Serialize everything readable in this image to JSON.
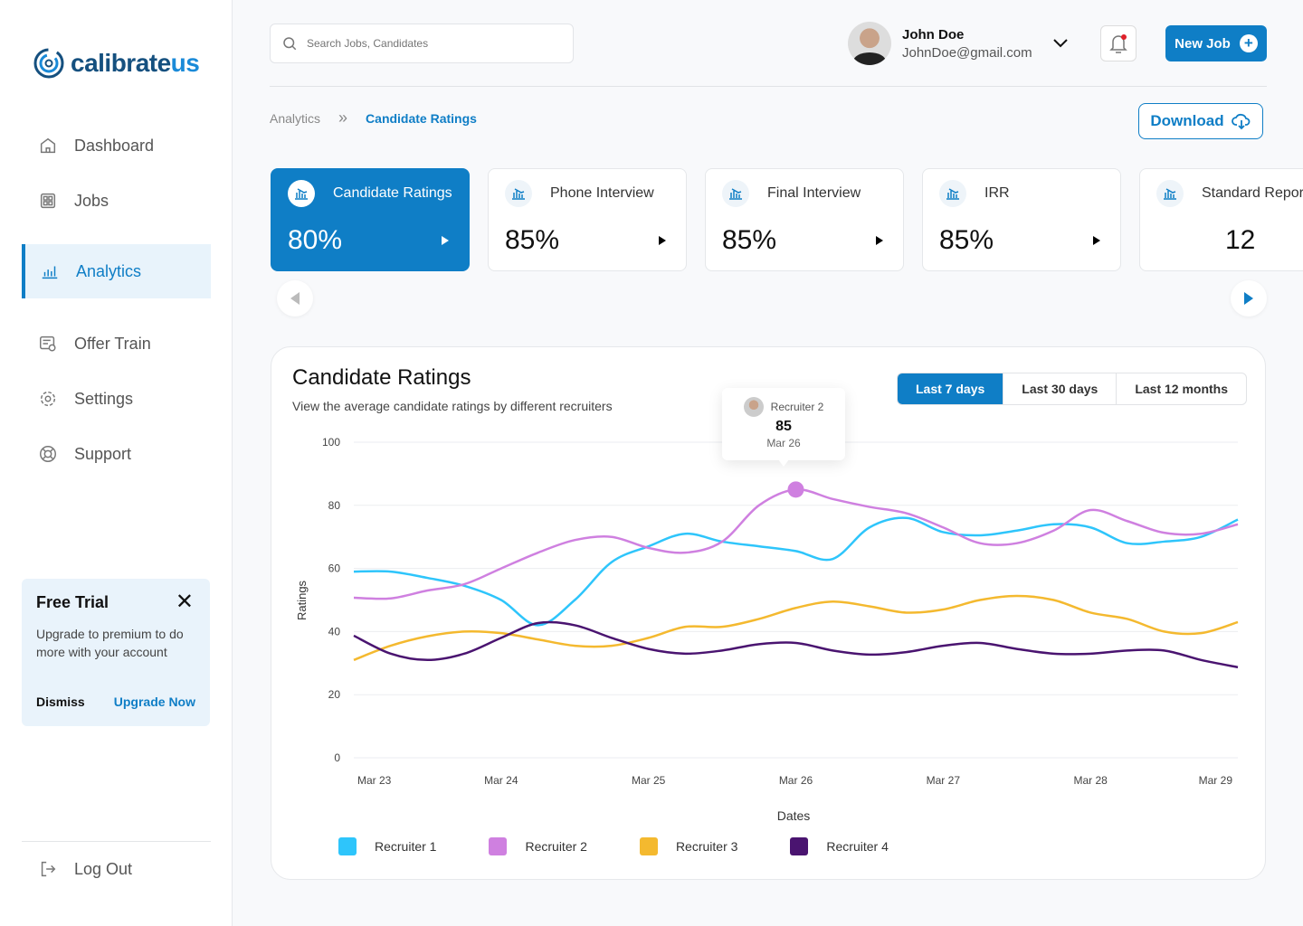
{
  "brand": {
    "name_a": "calibrate",
    "name_b": "us"
  },
  "sidebar": {
    "items": [
      {
        "label": "Dashboard",
        "icon": "home-icon"
      },
      {
        "label": "Jobs",
        "icon": "grid-icon"
      },
      {
        "label": "Analytics",
        "icon": "bar-chart-icon",
        "active": true
      },
      {
        "label": "Offer Train",
        "icon": "document-settings-icon"
      },
      {
        "label": "Settings",
        "icon": "gear-icon"
      },
      {
        "label": "Support",
        "icon": "lifebuoy-icon"
      }
    ],
    "logout": "Log Out"
  },
  "trial": {
    "title": "Free Trial",
    "text": "Upgrade to premium to do more with your account",
    "dismiss": "Dismiss",
    "upgrade": "Upgrade Now"
  },
  "header": {
    "search_placeholder": "Search Jobs, Candidates",
    "user_name": "John Doe",
    "user_email": "JohnDoe@gmail.com",
    "new_job": "New Job"
  },
  "breadcrumb": {
    "parent": "Analytics",
    "current": "Candidate Ratings"
  },
  "download": "Download",
  "cards": [
    {
      "label": "Candidate Ratings",
      "value": "80%",
      "active": true
    },
    {
      "label": "Phone Interview",
      "value": "85%"
    },
    {
      "label": "Final Interview",
      "value": "85%"
    },
    {
      "label": "IRR",
      "value": "85%"
    },
    {
      "label": "Standard Report",
      "value": "12"
    }
  ],
  "panel": {
    "title": "Candidate Ratings",
    "subtitle": "View the average candidate ratings by different recruiters",
    "ranges": [
      "Last 7 days",
      "Last 30 days",
      "Last 12 months"
    ],
    "active_range": "Last 7 days"
  },
  "tooltip": {
    "series": "Recruiter 2",
    "value": "85",
    "date": "Mar 26"
  },
  "colors": {
    "accent": "#0f7ec6",
    "r1": "#2ec5fb",
    "r2": "#cf80e0",
    "r3": "#f4b92f",
    "r4": "#4a1470"
  },
  "chart_data": {
    "type": "line",
    "xlabel": "Dates",
    "ylabel": "Ratings",
    "ylim": [
      0,
      100
    ],
    "grid": true,
    "legend": "bottom",
    "yticks": [
      "0",
      "20",
      "40",
      "60",
      "80",
      "100"
    ],
    "xticks": [
      "Mar 23",
      "Mar 24",
      "Mar 25",
      "Mar 26",
      "Mar 27",
      "Mar 28",
      "Mar 29"
    ],
    "x": [
      "Mar 23 00:00",
      "Mar 23 06:00",
      "Mar 23 12:00",
      "Mar 23 18:00",
      "Mar 24 00:00",
      "Mar 24 06:00",
      "Mar 24 12:00",
      "Mar 24 18:00",
      "Mar 25 00:00",
      "Mar 25 06:00",
      "Mar 25 12:00",
      "Mar 25 18:00",
      "Mar 26 00:00",
      "Mar 26 06:00",
      "Mar 26 12:00",
      "Mar 26 18:00",
      "Mar 27 00:00",
      "Mar 27 06:00",
      "Mar 27 12:00",
      "Mar 27 18:00",
      "Mar 28 00:00",
      "Mar 28 06:00",
      "Mar 28 12:00",
      "Mar 28 18:00",
      "Mar 29 00:00"
    ],
    "series": [
      {
        "name": "Recruiter 1",
        "values": [
          59,
          59,
          57,
          54.5,
          50,
          42,
          50,
          62,
          67,
          71,
          68.5,
          67,
          65.5,
          63,
          73,
          76,
          71.5,
          70.5,
          72,
          74,
          73,
          68,
          68.5,
          70,
          75.5
        ]
      },
      {
        "name": "Recruiter 2",
        "values": [
          50.7,
          50.5,
          53,
          55,
          60,
          65,
          69,
          70,
          66.5,
          65,
          68.5,
          80,
          85,
          82,
          79.5,
          77.5,
          73,
          68,
          68,
          72,
          78.5,
          75,
          71.3,
          71,
          74
        ]
      },
      {
        "name": "Recruiter 3",
        "values": [
          31,
          35.5,
          38.5,
          40,
          39.5,
          37.5,
          35.5,
          35.5,
          38,
          41.5,
          41.5,
          44,
          47.5,
          49.5,
          48,
          46,
          47,
          50,
          51.3,
          50,
          46,
          44,
          40,
          39.5,
          43
        ]
      },
      {
        "name": "Recruiter 4",
        "values": [
          38.7,
          33,
          31,
          33,
          38,
          42.7,
          42,
          38,
          34.5,
          33,
          34,
          36,
          36.4,
          34,
          32.7,
          33.5,
          35.5,
          36.4,
          34.5,
          33,
          33,
          34,
          34,
          31,
          28.7
        ]
      }
    ]
  }
}
